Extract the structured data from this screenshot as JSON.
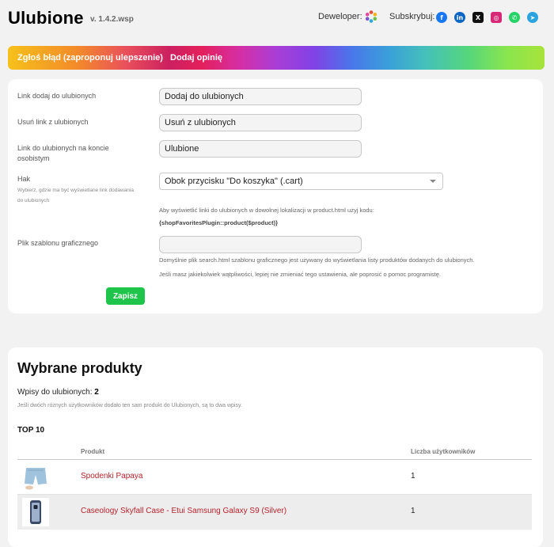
{
  "header": {
    "title": "Ulubione",
    "version": "v. 1.4.2.wsp",
    "developer_label": "Deweloper:",
    "subscribe_label": "Subskrybuj:",
    "social": [
      {
        "name": "facebook-icon",
        "glyph": "f",
        "color": "#1877f2"
      },
      {
        "name": "linkedin-icon",
        "glyph": "in",
        "color": "#0a66c2"
      },
      {
        "name": "x-icon",
        "glyph": "X",
        "color": "#111111"
      },
      {
        "name": "instagram-icon",
        "glyph": "◎",
        "color": "#d62976"
      },
      {
        "name": "whatsapp-icon",
        "glyph": "✆",
        "color": "#25d366"
      },
      {
        "name": "telegram-icon",
        "glyph": "➤",
        "color": "#2aa3df"
      }
    ]
  },
  "banner": {
    "report_link": "Zgłoś błąd (zaproponuj ulepszenie)",
    "review_link": "Dodaj opinię"
  },
  "settings": {
    "add_link_label": "Link dodaj do ulubionych",
    "add_link_value": "Dodaj do ulubionych",
    "remove_link_label": "Usuń link z ulubionych",
    "remove_link_value": "Usuń z ulubionych",
    "account_link_label": "Link do ulubionych na koncie osobistym",
    "account_link_value": "Ulubione",
    "hook_label": "Hak",
    "hook_hint": "Wybierz, gdzie ma być wyświetlane link dodawania do ulubionych",
    "hook_value": "Obok przycisku \"Do koszyka\" (.cart)",
    "hook_note": "Aby wyświetlić linki do ulubionych w dowolnej lokalizacji w product.html użyj kodu:",
    "hook_code": "{shopFavoritesPlugin::product($product)}",
    "template_label": "Plik szablonu graficznego",
    "template_value": "",
    "template_note_1": "Domyślnie plik search.html szablonu graficznego jest używany do wyświetlania listy produktów dodanych do ulubionych.",
    "template_note_2": "Jeśli masz jakiekolwiek wątpliwości, lepiej nie zmieniać tego ustawienia, ale poprosić o pomoc programistę.",
    "save_label": "Zapisz"
  },
  "products": {
    "title": "Wybrane produkty",
    "count_label": "Wpisy do ulubionych:",
    "count_value": "2",
    "count_note": "Jeśli dwóch różnych użytkowników dodało ten sam produkt do Ulubionych, są to dwa wpisy.",
    "top_label": "TOP 10",
    "col_product": "Produkt",
    "col_users": "Liczba użytkowników",
    "rows": [
      {
        "name": "Spodenki Papaya",
        "users": "1"
      },
      {
        "name": "Caseology Skyfall Case - Etui Samsung Galaxy S9 (Silver)",
        "users": "1"
      }
    ]
  },
  "colors": {
    "accent_green": "#1fc54a",
    "product_link": "#b5222d"
  }
}
